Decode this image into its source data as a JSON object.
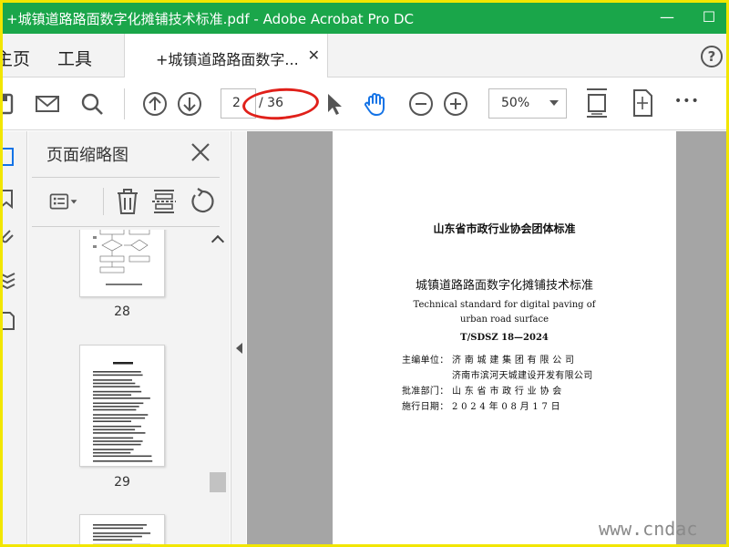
{
  "window": {
    "title": "+城镇道路路面数字化摊铺技术标准.pdf - Adobe Acrobat Pro DC",
    "minimize_glyph": "—",
    "maximize_glyph": "☐"
  },
  "nav": {
    "home_label": "主页",
    "tools_label": "工具",
    "doc_tab_label": "+城镇道路路面数字...",
    "close_tab_glyph": "✕",
    "help_glyph": "?"
  },
  "toolbar": {
    "current_page": "2",
    "total_pages": "/ 36",
    "zoom": "50%",
    "more_glyph": "•••"
  },
  "thumbnails": {
    "title": "页面缩略图",
    "pages": [
      {
        "number": "28"
      },
      {
        "number": "29"
      }
    ]
  },
  "document": {
    "association": "山东省市政行业协会团体标准",
    "title_cn": "城镇道路路面数字化摊铺技术标准",
    "title_en_line1": "Technical standard for digital paving of",
    "title_en_line2": "urban road surface",
    "code": "T/SDSZ 18—2024",
    "editor_label": "主编单位：",
    "editor_1": "济 南 城 建 集 团 有 限 公 司",
    "editor_2": "济南市滨河天城建设开发有限公司",
    "approver_label": "批准部门：",
    "approver": "山 东 省 市 政 行 业 协 会",
    "effective_label": "施行日期：",
    "effective_date": "2 0 2 4 年 0 8 月 1 7 日"
  },
  "watermark": "www.cndac",
  "colors": {
    "titlebar": "#1aa64a",
    "frame": "#f2e600",
    "accent_blue": "#1473e6",
    "annotation_red": "#e0201a"
  },
  "icons": [
    "save-icon",
    "mail-icon",
    "search-icon",
    "prev-page-icon",
    "next-page-icon",
    "select-cursor-icon",
    "hand-tool-icon",
    "zoom-out-icon",
    "zoom-in-icon",
    "fit-width-icon",
    "fit-page-icon",
    "more-icon",
    "page-thumbnails-icon",
    "bookmark-icon",
    "attachment-icon",
    "layers-icon",
    "pages-icon",
    "options-icon",
    "delete-icon",
    "insert-icon",
    "rotate-icon",
    "close-icon"
  ]
}
